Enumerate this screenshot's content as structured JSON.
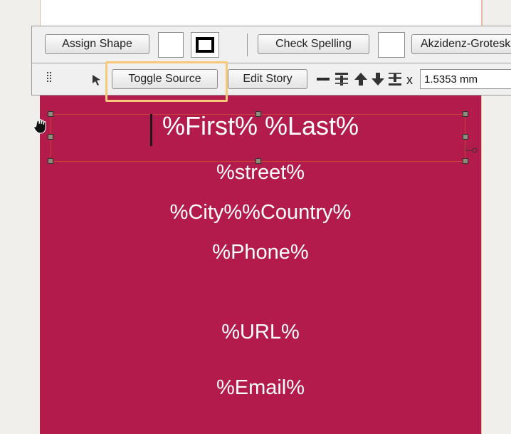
{
  "toolbar": {
    "assign_shape": "Assign Shape",
    "check_spelling": "Check Spelling",
    "font_name": "Akzidenz-Grotesk",
    "toggle_source": "Toggle Source",
    "edit_story": "Edit Story",
    "x_label": "x",
    "x_value": "1.5353 mm"
  },
  "document": {
    "name_line": "%First% %Last%",
    "street": "%street%",
    "city_country": "%City%%Country%",
    "phone": "%Phone%",
    "url": "%URL%",
    "email": "%Email%"
  },
  "colors": {
    "page_background": "#b31b4c",
    "highlight": "#f7c77a",
    "selection": "#c8433a"
  },
  "icons": [
    "grip-icon",
    "pointer-arrow-icon",
    "minus-icon",
    "align-top-icon",
    "arrow-up-icon",
    "arrow-down-icon",
    "align-bottom-icon",
    "hand-cursor-icon"
  ]
}
